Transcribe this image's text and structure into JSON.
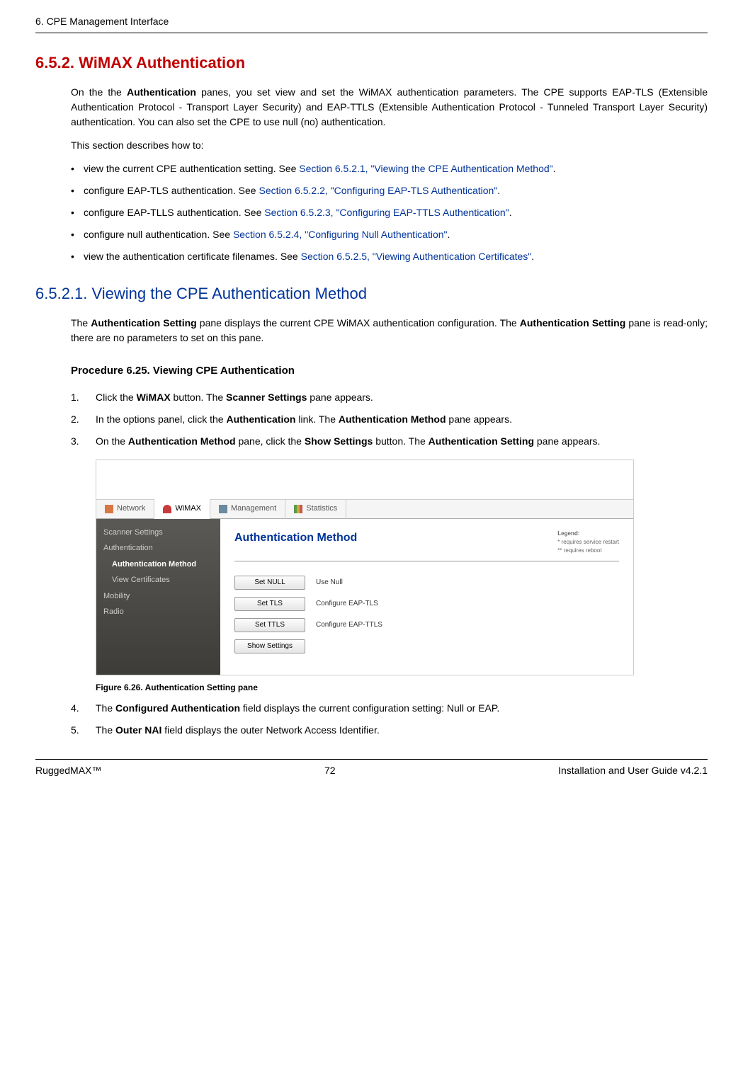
{
  "header": {
    "chapter": "6. CPE Management Interface"
  },
  "section_652": {
    "number": "6.5.2.",
    "title": "WiMAX Authentication",
    "intro_part1": "On the the ",
    "intro_bold1": "Authentication",
    "intro_part2": " panes, you set view and set the WiMAX authentication parameters. The CPE supports EAP-TLS (Extensible Authentication Protocol - Transport Layer Security) and EAP-TTLS (Extensible Authentication Protocol - Tunneled Transport Layer Security) authentication. You can also set the CPE to use null (no) authentication.",
    "intro_line2": "This section describes how to:",
    "bullets": [
      {
        "text": "view the current CPE authentication setting. See ",
        "link": "Section 6.5.2.1, \"Viewing the CPE Authentication Method\"",
        "suffix": "."
      },
      {
        "text": "configure EAP-TLS authentication. See ",
        "link": "Section 6.5.2.2, \"Configuring EAP-TLS Authentication\"",
        "suffix": "."
      },
      {
        "text": "configure EAP-TLLS authentication. See ",
        "link": "Section 6.5.2.3, \"Configuring EAP-TTLS Authentication\"",
        "suffix": "."
      },
      {
        "text": "configure null authentication. See ",
        "link": "Section 6.5.2.4, \"Configuring Null Authentication\"",
        "suffix": "."
      },
      {
        "text": "view the authentication certificate filenames. See ",
        "link": "Section 6.5.2.5, \"Viewing Authentication Certificates\"",
        "suffix": "."
      }
    ]
  },
  "section_6521": {
    "title": "6.5.2.1. Viewing the CPE Authentication Method",
    "para_part1": "The ",
    "para_bold1": "Authentication Setting",
    "para_part2": " pane displays the current CPE WiMAX authentication configuration. The ",
    "para_bold2": "Authentication Setting",
    "para_part3": " pane is read-only; there are no parameters to set on this pane."
  },
  "procedure": {
    "title": "Procedure 6.25. Viewing CPE Authentication",
    "steps": {
      "s1_a": "Click the ",
      "s1_b1": "WiMAX",
      "s1_b": " button. The ",
      "s1_b2": "Scanner Settings",
      "s1_c": " pane appears.",
      "s2_a": "In the options panel, click the ",
      "s2_b1": "Authentication",
      "s2_b": " link. The ",
      "s2_b2": "Authentication Method",
      "s2_c": " pane appears.",
      "s3_a": "On the ",
      "s3_b1": "Authentication Method",
      "s3_b": " pane, click the ",
      "s3_b2": "Show Settings",
      "s3_c": " button. The ",
      "s3_b3": "Authentication Setting",
      "s3_d": " pane appears.",
      "s4_a": "The ",
      "s4_b1": "Configured Authentication",
      "s4_b": " field displays the current configuration setting: Null or EAP.",
      "s5_a": "The ",
      "s5_b1": "Outer NAI",
      "s5_b": " field displays the outer Network Access Identifier."
    }
  },
  "screenshot": {
    "tabs": {
      "network": "Network",
      "wimax": "WiMAX",
      "management": "Management",
      "statistics": "Statistics"
    },
    "sidebar": {
      "scanner": "Scanner Settings",
      "auth": "Authentication",
      "auth_method": "Authentication Method",
      "view_cert": "View Certificates",
      "mobility": "Mobility",
      "radio": "Radio"
    },
    "panel_title": "Authentication Method",
    "legend_title": "Legend:",
    "legend_l1": "* requires service restart",
    "legend_l2": "** requires reboot",
    "buttons": {
      "set_null": "Set NULL",
      "set_tls": "Set TLS",
      "set_ttls": "Set TTLS",
      "show_settings": "Show Settings"
    },
    "labels": {
      "use_null": "Use Null",
      "conf_tls": "Configure EAP-TLS",
      "conf_ttls": "Configure EAP-TTLS"
    }
  },
  "figure_caption": "Figure 6.26. Authentication Setting pane",
  "footer": {
    "left": "RuggedMAX™",
    "center": "72",
    "right": "Installation and User Guide v4.2.1"
  }
}
